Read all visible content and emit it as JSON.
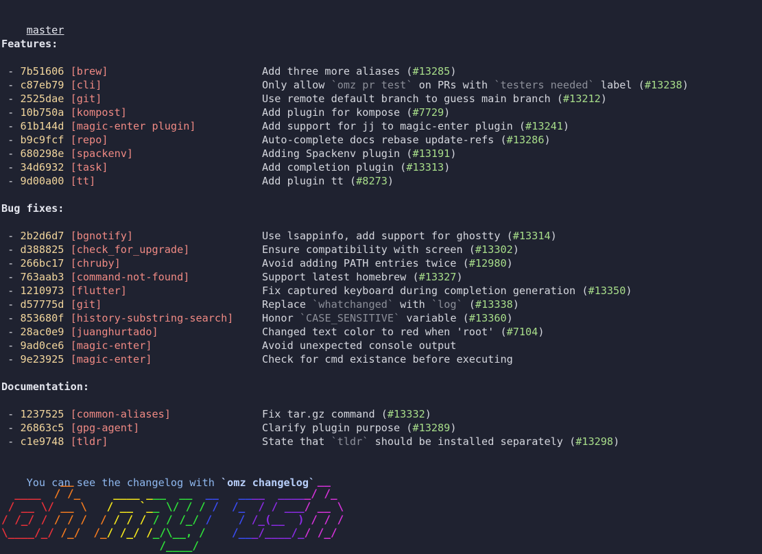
{
  "branch": "master",
  "sections": [
    {
      "title": "Features:",
      "items": [
        {
          "hash": "7b51606",
          "scope": "brew",
          "parts": [
            {
              "t": "Add three more aliases ("
            },
            {
              "t": "#13285",
              "k": "pr"
            },
            {
              "t": ")"
            }
          ]
        },
        {
          "hash": "c87eb79",
          "scope": "cli",
          "parts": [
            {
              "t": "Only allow "
            },
            {
              "t": "`omz pr test`",
              "k": "code"
            },
            {
              "t": " on PRs with "
            },
            {
              "t": "`testers needed`",
              "k": "code"
            },
            {
              "t": " label ("
            },
            {
              "t": "#13238",
              "k": "pr"
            },
            {
              "t": ")"
            }
          ]
        },
        {
          "hash": "2525dae",
          "scope": "git",
          "parts": [
            {
              "t": "Use remote default branch to guess main branch ("
            },
            {
              "t": "#13212",
              "k": "pr"
            },
            {
              "t": ")"
            }
          ]
        },
        {
          "hash": "10b750a",
          "scope": "kompost",
          "parts": [
            {
              "t": "Add plugin for kompose ("
            },
            {
              "t": "#7729",
              "k": "pr"
            },
            {
              "t": ")"
            }
          ]
        },
        {
          "hash": "61b144d",
          "scope": "magic-enter plugin",
          "parts": [
            {
              "t": "Add support for jj to magic-enter plugin ("
            },
            {
              "t": "#13241",
              "k": "pr"
            },
            {
              "t": ")"
            }
          ]
        },
        {
          "hash": "b9c9fcf",
          "scope": "repo",
          "parts": [
            {
              "t": "Auto-complete docs rebase update-refs ("
            },
            {
              "t": "#13286",
              "k": "pr"
            },
            {
              "t": ")"
            }
          ]
        },
        {
          "hash": "680298e",
          "scope": "spackenv",
          "parts": [
            {
              "t": "Adding Spackenv plugin ("
            },
            {
              "t": "#13191",
              "k": "pr"
            },
            {
              "t": ")"
            }
          ]
        },
        {
          "hash": "34d6932",
          "scope": "task",
          "parts": [
            {
              "t": "Add completion plugin ("
            },
            {
              "t": "#13313",
              "k": "pr"
            },
            {
              "t": ")"
            }
          ]
        },
        {
          "hash": "9d00a00",
          "scope": "tt",
          "parts": [
            {
              "t": "Add plugin tt ("
            },
            {
              "t": "#8273",
              "k": "pr"
            },
            {
              "t": ")"
            }
          ]
        }
      ]
    },
    {
      "title": "Bug fixes:",
      "items": [
        {
          "hash": "2b2d6d7",
          "scope": "bgnotify",
          "parts": [
            {
              "t": "Use lsappinfo, add support for ghostty ("
            },
            {
              "t": "#13314",
              "k": "pr"
            },
            {
              "t": ")"
            }
          ]
        },
        {
          "hash": "d388825",
          "scope": "check_for_upgrade",
          "parts": [
            {
              "t": "Ensure compatibility with screen ("
            },
            {
              "t": "#13302",
              "k": "pr"
            },
            {
              "t": ")"
            }
          ]
        },
        {
          "hash": "266bc17",
          "scope": "chruby",
          "parts": [
            {
              "t": "Avoid adding PATH entries twice ("
            },
            {
              "t": "#12980",
              "k": "pr"
            },
            {
              "t": ")"
            }
          ]
        },
        {
          "hash": "763aab3",
          "scope": "command-not-found",
          "parts": [
            {
              "t": "Support latest homebrew ("
            },
            {
              "t": "#13327",
              "k": "pr"
            },
            {
              "t": ")"
            }
          ]
        },
        {
          "hash": "1210973",
          "scope": "flutter",
          "parts": [
            {
              "t": "Fix captured keyboard during completion generation ("
            },
            {
              "t": "#13350",
              "k": "pr"
            },
            {
              "t": ")"
            }
          ]
        },
        {
          "hash": "d57775d",
          "scope": "git",
          "parts": [
            {
              "t": "Replace "
            },
            {
              "t": "`whatchanged`",
              "k": "code"
            },
            {
              "t": " with "
            },
            {
              "t": "`log`",
              "k": "code"
            },
            {
              "t": " ("
            },
            {
              "t": "#13338",
              "k": "pr"
            },
            {
              "t": ")"
            }
          ]
        },
        {
          "hash": "853680f",
          "scope": "history-substring-search",
          "parts": [
            {
              "t": "Honor "
            },
            {
              "t": "`CASE_SENSITIVE`",
              "k": "code"
            },
            {
              "t": " variable ("
            },
            {
              "t": "#13360",
              "k": "pr"
            },
            {
              "t": ")"
            }
          ]
        },
        {
          "hash": "28ac0e9",
          "scope": "juanghurtado",
          "parts": [
            {
              "t": "Changed text color to red when 'root' ("
            },
            {
              "t": "#7104",
              "k": "pr"
            },
            {
              "t": ")"
            }
          ]
        },
        {
          "hash": "9ad0ce6",
          "scope": "magic-enter",
          "parts": [
            {
              "t": "Avoid unexpected console output"
            }
          ]
        },
        {
          "hash": "9e23925",
          "scope": "magic-enter",
          "parts": [
            {
              "t": "Check for cmd existance before executing"
            }
          ]
        }
      ]
    },
    {
      "title": "Documentation:",
      "items": [
        {
          "hash": "1237525",
          "scope": "common-aliases",
          "parts": [
            {
              "t": "Fix tar.gz command ("
            },
            {
              "t": "#13332",
              "k": "pr"
            },
            {
              "t": ")"
            }
          ]
        },
        {
          "hash": "26863c5",
          "scope": "gpg-agent",
          "parts": [
            {
              "t": "Clarify plugin purpose ("
            },
            {
              "t": "#13289",
              "k": "pr"
            },
            {
              "t": ")"
            }
          ]
        },
        {
          "hash": "c1e9748",
          "scope": "tldr",
          "parts": [
            {
              "t": "State that "
            },
            {
              "t": "`tldr`",
              "k": "code"
            },
            {
              "t": " should be installed separately ("
            },
            {
              "t": "#13298",
              "k": "pr"
            },
            {
              "t": ")"
            }
          ]
        }
      ]
    }
  ],
  "hint": {
    "prefix": "You can see the changelog with ",
    "command": "`omz changelog`"
  },
  "logo": {
    "lines": [
      "         __                                     __   ",
      "  ____  / /_     ____ ___  __  __   ____  _____/ /_  ",
      " / __ \\/ __ \\   / __ `__ \\/ / / /  /_  / / ___/ __ \\ ",
      "/ /_/ / / / /  / / / / / / /_/ /    / /_(__  ) / / / ",
      "\\____/_/ /_/  /_/ /_/ /_/\\__, /    /___/____/_/ /_/  ",
      "                        /____/                       "
    ],
    "colors": [
      "#e8313a",
      "#f27a1f",
      "#f5e71c",
      "#2fe03a",
      "#3a4cf2",
      "#8a2be2",
      "#d432d8"
    ]
  }
}
